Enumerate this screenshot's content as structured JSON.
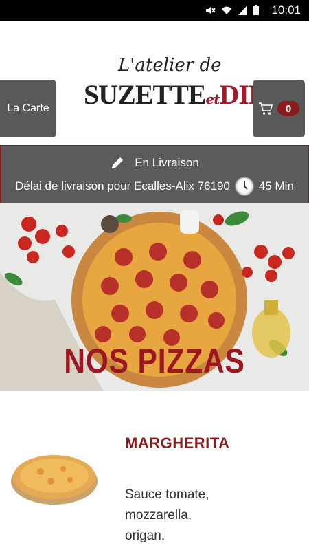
{
  "status_bar": {
    "time": "10:01"
  },
  "header": {
    "menu_button_label": "La Carte",
    "cart_count": "0",
    "logo": {
      "line1": "L'atelier de",
      "name_part1": "SUZETTE",
      "connector": "et",
      "name_part2": "DINO"
    }
  },
  "delivery": {
    "mode": "En Livraison",
    "delay_text": "Délai de livraison pour Ecalles-Alix 76190",
    "time": "45 Min"
  },
  "hero": {
    "title": "NOS PIZZAS"
  },
  "product": {
    "name": "MARGHERITA",
    "description": "Sauce tomate, mozzarella, origan."
  },
  "colors": {
    "accent": "#8b1a1a",
    "button_bg": "#595959",
    "delivery_bg": "#5b5b5b"
  }
}
